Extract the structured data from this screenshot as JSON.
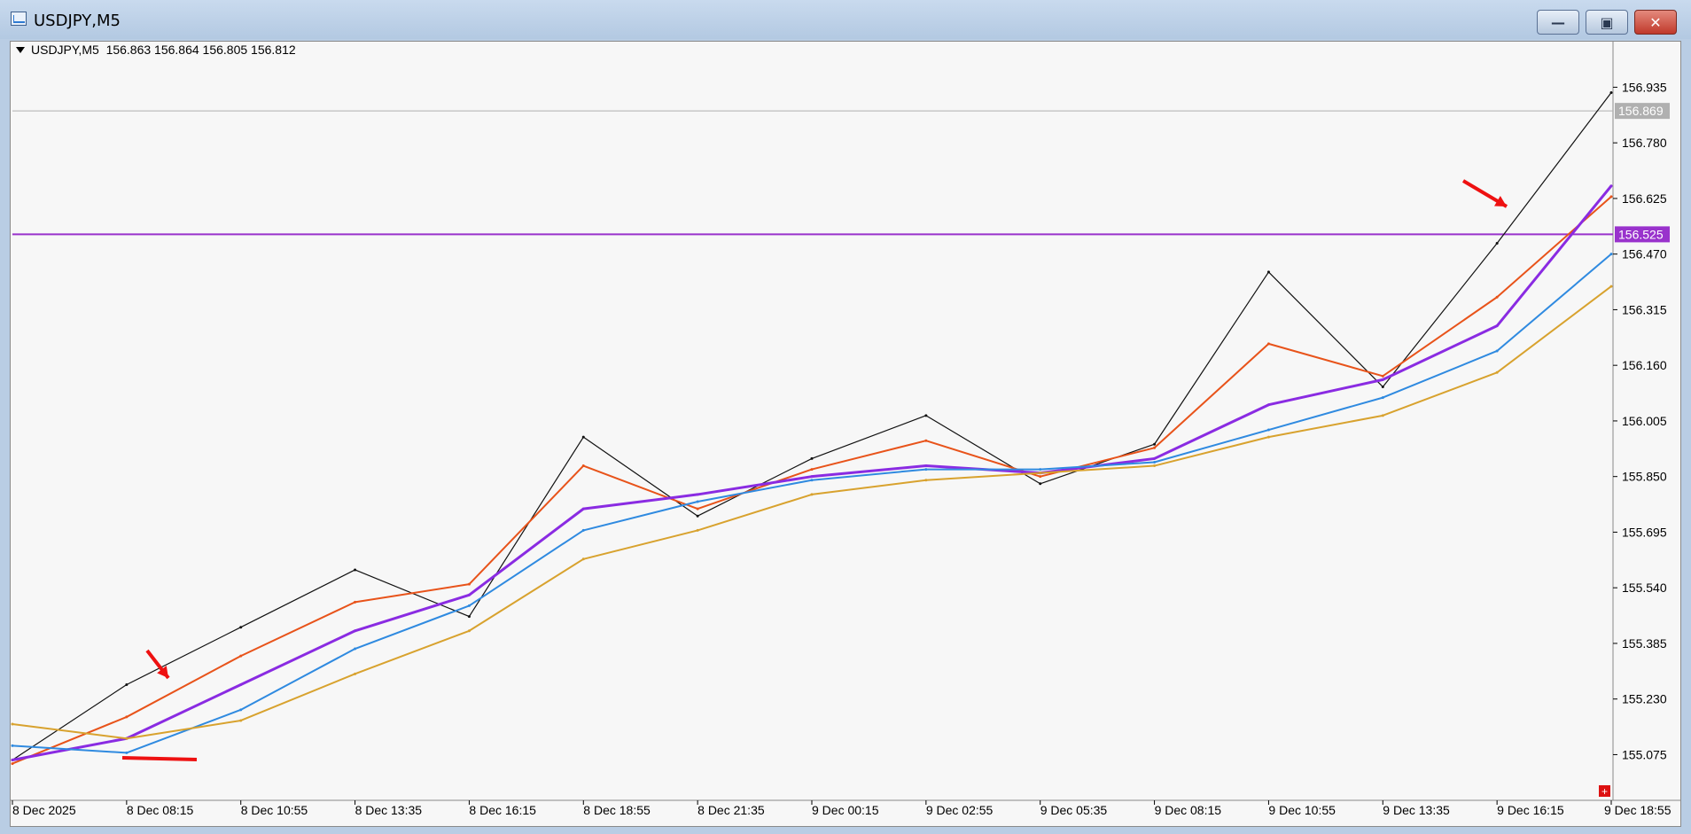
{
  "window": {
    "title": "USDJPY,M5",
    "buttons": {
      "minimize": "—",
      "maximize": "▣",
      "close": "✕"
    }
  },
  "header": {
    "symbol": "USDJPY,M5",
    "quote": "156.863 156.864 156.805 156.812"
  },
  "chart_data": {
    "type": "line",
    "title": "",
    "xlabel": "",
    "ylabel": "",
    "ylim": [
      154.96,
      157.02
    ],
    "y_ticks": [
      "156.935",
      "156.780",
      "156.625",
      "156.470",
      "156.315",
      "156.160",
      "156.005",
      "155.850",
      "155.695",
      "155.540",
      "155.385",
      "155.230",
      "155.075"
    ],
    "x_ticks": [
      "8 Dec 2025",
      "8 Dec 08:15",
      "8 Dec 10:55",
      "8 Dec 13:35",
      "8 Dec 16:15",
      "8 Dec 18:55",
      "8 Dec 21:35",
      "9 Dec 00:15",
      "9 Dec 02:55",
      "9 Dec 05:35",
      "9 Dec 08:15",
      "9 Dec 10:55",
      "9 Dec 13:35",
      "9 Dec 16:15",
      "9 Dec 18:55"
    ],
    "x": [
      0,
      1,
      2,
      3,
      4,
      5,
      6,
      7,
      8,
      9,
      10,
      11,
      12,
      13,
      14
    ],
    "series": [
      {
        "color": "#111111",
        "values": [
          155.06,
          155.27,
          155.43,
          155.59,
          155.46,
          155.96,
          155.74,
          155.9,
          156.02,
          155.83,
          155.94,
          156.42,
          156.1,
          156.5,
          156.92
        ]
      },
      {
        "color": "#e8531a",
        "values": [
          155.05,
          155.18,
          155.35,
          155.5,
          155.55,
          155.88,
          155.76,
          155.87,
          155.95,
          155.85,
          155.93,
          156.22,
          156.13,
          156.35,
          156.63
        ]
      },
      {
        "color": "#8a2be2",
        "values": [
          155.06,
          155.12,
          155.27,
          155.42,
          155.52,
          155.76,
          155.8,
          155.85,
          155.88,
          155.86,
          155.9,
          156.05,
          156.12,
          156.27,
          156.66
        ]
      },
      {
        "color": "#2f8ae0",
        "values": [
          155.1,
          155.08,
          155.2,
          155.37,
          155.49,
          155.7,
          155.78,
          155.84,
          155.87,
          155.87,
          155.89,
          155.98,
          156.07,
          156.2,
          156.47
        ]
      },
      {
        "color": "#d8a22e",
        "values": [
          155.16,
          155.12,
          155.17,
          155.3,
          155.42,
          155.62,
          155.7,
          155.8,
          155.84,
          155.86,
          155.88,
          155.96,
          156.02,
          156.14,
          156.38
        ]
      }
    ],
    "levels": [
      {
        "value": 156.869,
        "label": "156.869",
        "color": "#b0b0b0"
      },
      {
        "value": 156.525,
        "label": "156.525",
        "color": "#9932cc"
      }
    ],
    "markers": {
      "right_edge_badge": "+"
    }
  }
}
